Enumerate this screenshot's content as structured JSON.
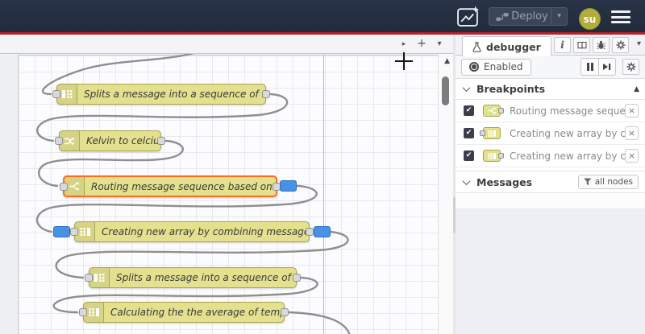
{
  "header": {
    "bg_color": "#232d3b",
    "accent_line_color": "#b8202e",
    "deploy": {
      "label": "Deploy"
    },
    "user_badge": "su"
  },
  "icons": {
    "check": "✔",
    "close": "×",
    "caret_down": "▾",
    "scroll_up": "▲",
    "play": "▸",
    "plus": "+",
    "info": "i"
  },
  "canvas": {
    "node_fill": "#e3e08e",
    "node_border": "#a9a44f",
    "selected_border": "#ff6b1f",
    "breakpoint_badge_color": "#4892e3",
    "wire_color": "#8f8f8f",
    "nodes": [
      {
        "label": "Splits a message into a sequence of messages.",
        "type": "split"
      },
      {
        "label": "Kelvin to celcius",
        "type": "change"
      },
      {
        "label": "Routing message sequence based on condition",
        "type": "switch",
        "selected": true,
        "breakpoint_on": "output"
      },
      {
        "label": "Creating new array by combining message sequence",
        "type": "join",
        "breakpoint_on": "input and output"
      },
      {
        "label": "Splits a message into a sequence of messages.",
        "type": "split"
      },
      {
        "label": "Calculating the the average of temperature",
        "type": "join"
      }
    ]
  },
  "sidebar": {
    "tab_label": "debugger",
    "toolbar": {
      "enabled_label": "Enabled"
    },
    "breakpoints": {
      "title": "Breakpoints",
      "items": [
        {
          "checked": true,
          "node_type": "switch",
          "port": "output",
          "label": "Routing message sequence ba"
        },
        {
          "checked": true,
          "node_type": "join",
          "port": "input",
          "label": "Creating new array by combini"
        },
        {
          "checked": true,
          "node_type": "join",
          "port": "output",
          "label": "Creating new array by combini"
        }
      ]
    },
    "messages": {
      "title": "Messages",
      "filter_label": "all nodes"
    }
  }
}
